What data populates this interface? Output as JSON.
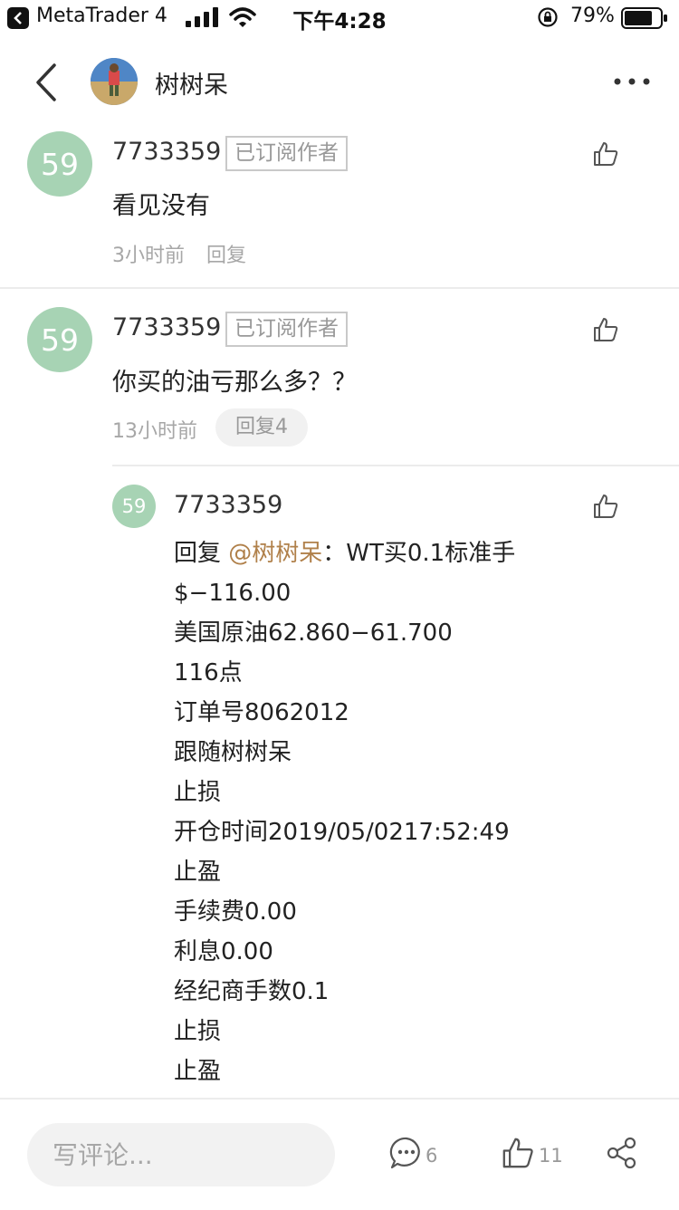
{
  "status_bar": {
    "app_name": "MetaTrader 4",
    "time": "下午4:28",
    "battery_text": "79%",
    "battery_level": 0.79
  },
  "nav": {
    "title": "树树呆"
  },
  "comments": [
    {
      "avatar_text": "59",
      "username": "7733359",
      "badge": "已订阅作者",
      "content": "看见没有",
      "time": "3小时前",
      "reply": "回复"
    },
    {
      "avatar_text": "59",
      "username": "7733359",
      "badge": "已订阅作者",
      "content": "你买的油亏那么多？？",
      "time": "13小时前",
      "reply": "回复4"
    }
  ],
  "reply": {
    "avatar_text": "59",
    "username": "7733359",
    "prefix": "回复 ",
    "mention": "@树树呆",
    "first_line_rest": "：WT买0.1标准手",
    "lines": [
      "$−116.00",
      "美国原油62.860−61.700",
      "116点",
      "订单号8062012",
      "跟随树树呆",
      "止损",
      "开仓时间2019/05/0217:52:49",
      "止盈",
      "手续费0.00",
      "利息0.00",
      "经纪商手数0.1",
      "止损",
      "止盈"
    ]
  },
  "bottom_bar": {
    "input_placeholder": "写评论...",
    "comment_count": "6",
    "like_count": "11"
  },
  "colors": {
    "avatar_bg": "#a7d3b4",
    "mention": "#b0804a"
  },
  "icons": [
    "back-icon",
    "signal-icon",
    "wifi-icon",
    "orientation-lock-icon",
    "battery-icon",
    "chevron-left-icon",
    "more-icon",
    "thumbs-up-icon",
    "comment-icon",
    "share-icon"
  ]
}
